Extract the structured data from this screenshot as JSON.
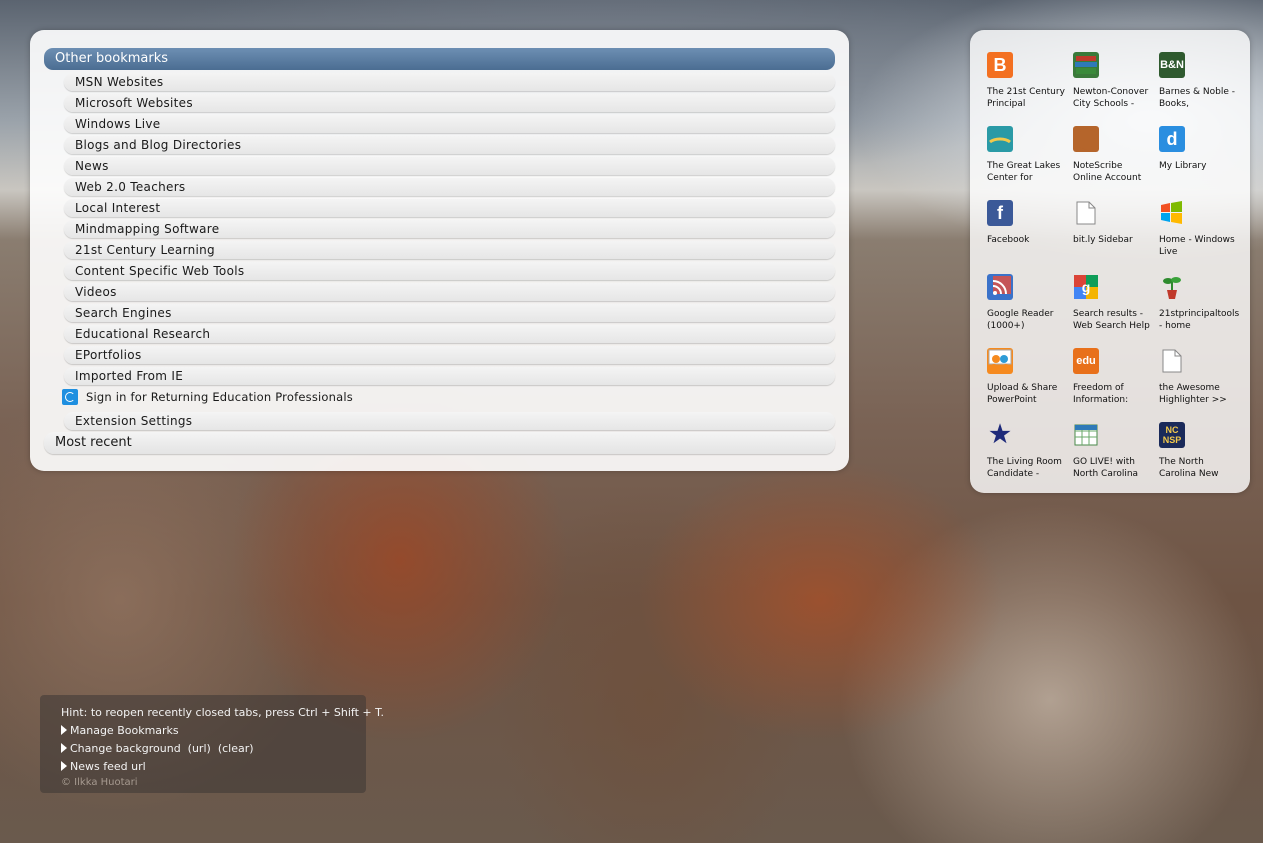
{
  "bookmarks": {
    "header": "Other bookmarks",
    "folders": [
      "MSN Websites",
      "Microsoft Websites",
      "Windows Live",
      "Blogs and Blog Directories",
      "News",
      "Web 2.0 Teachers",
      "Local Interest",
      "Mindmapping Software",
      "21st Century Learning",
      "Content Specific Web Tools",
      "Videos",
      "Search Engines",
      "Educational Research",
      "EPortfolios",
      "Imported From IE"
    ],
    "link": "Sign in for Returning Education Professionals",
    "extension_settings": "Extension Settings",
    "most_recent": "Most recent"
  },
  "speed_dial": [
    {
      "line1": "The 21st Century",
      "line2": "Principal",
      "icon": "blogger-icon",
      "glyph": "B",
      "color": "#f37021"
    },
    {
      "line1": "Newton-Conover",
      "line2": "City Schools -",
      "icon": "books-icon",
      "glyph": "",
      "color": "#3a7a3a"
    },
    {
      "line1": "Barnes & Noble -",
      "line2": "Books,",
      "icon": "barnes-noble-icon",
      "glyph": "B&N",
      "color": "#2f5a2f"
    },
    {
      "line1": "The Great Lakes",
      "line2": "Center for",
      "icon": "great-lakes-icon",
      "glyph": "",
      "color": "#2a9aa6"
    },
    {
      "line1": "NoteScribe",
      "line2": "Online Account",
      "icon": "notescribe-icon",
      "glyph": "",
      "color": "#b5652b"
    },
    {
      "line1": "My Library",
      "line2": "",
      "icon": "delicious-icon",
      "glyph": "d",
      "color": "#2a8ee0"
    },
    {
      "line1": "Facebook",
      "line2": "",
      "icon": "facebook-icon",
      "glyph": "f",
      "color": "#3b5998"
    },
    {
      "line1": "bit.ly Sidebar",
      "line2": "",
      "icon": "page-icon",
      "glyph": "",
      "color": "#ffffff"
    },
    {
      "line1": "Home - Windows",
      "line2": "Live",
      "icon": "windows-icon",
      "glyph": "",
      "color": "#ffffff"
    },
    {
      "line1": "Google Reader",
      "line2": "(1000+)",
      "icon": "rss-reader-icon",
      "glyph": "",
      "color": "#3b72c9"
    },
    {
      "line1": "Search results -",
      "line2": "Web Search Help",
      "icon": "google-icon",
      "glyph": "g",
      "color": "#ffffff"
    },
    {
      "line1": "21stprincipaltools",
      "line2": "- home",
      "icon": "plant-icon",
      "glyph": "",
      "color": "#ffffff"
    },
    {
      "line1": "Upload & Share",
      "line2": "PowerPoint",
      "icon": "slideshare-icon",
      "glyph": "",
      "color": "#f58a1f"
    },
    {
      "line1": "Freedom of",
      "line2": "Information:",
      "icon": "edu-icon",
      "glyph": "edu",
      "color": "#e8701a"
    },
    {
      "line1": "the Awesome",
      "line2": "Highlighter >>",
      "icon": "page-icon",
      "glyph": "",
      "color": "#ffffff"
    },
    {
      "line1": "The Living Room",
      "line2": "Candidate -",
      "icon": "star-icon",
      "glyph": "★",
      "color": "#ffffff"
    },
    {
      "line1": "GO LIVE! with",
      "line2": "North Carolina",
      "icon": "spreadsheet-icon",
      "glyph": "",
      "color": "#ffffff"
    },
    {
      "line1": "The North",
      "line2": "Carolina New",
      "icon": "ncnsp-icon",
      "glyph": "NC NSP",
      "color": "#1a2a5a"
    }
  ],
  "hint": {
    "text": "Hint: to reopen recently closed tabs, press Ctrl + Shift + T.",
    "manage": "Manage Bookmarks",
    "change_bg": "Change background",
    "url": "(url)",
    "clear": "(clear)",
    "news_feed": "News feed url",
    "credit": "© Ilkka Huotari"
  }
}
